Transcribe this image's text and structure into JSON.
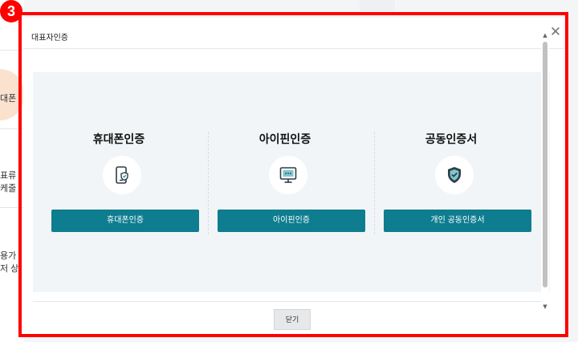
{
  "background": {
    "texts": [
      "대폰",
      "표류",
      "케줄",
      "용가",
      "저 상"
    ]
  },
  "modal": {
    "title": "대표자인증",
    "close_glyph": "✕",
    "options": [
      {
        "title": "휴대폰인증",
        "button": "휴대폰인증",
        "icon": "phone-shield-icon"
      },
      {
        "title": "아이핀인증",
        "button": "아이핀인증",
        "icon": "monitor-icon"
      },
      {
        "title": "공동인증서",
        "button": "개인 공동인증서",
        "icon": "shield-check-icon"
      }
    ],
    "close_button": "닫기"
  },
  "annotation": {
    "step_number": "3",
    "color": "#ff0000"
  },
  "colors": {
    "accent": "#0e7d8f",
    "panel_bg": "#f1f5f7"
  }
}
